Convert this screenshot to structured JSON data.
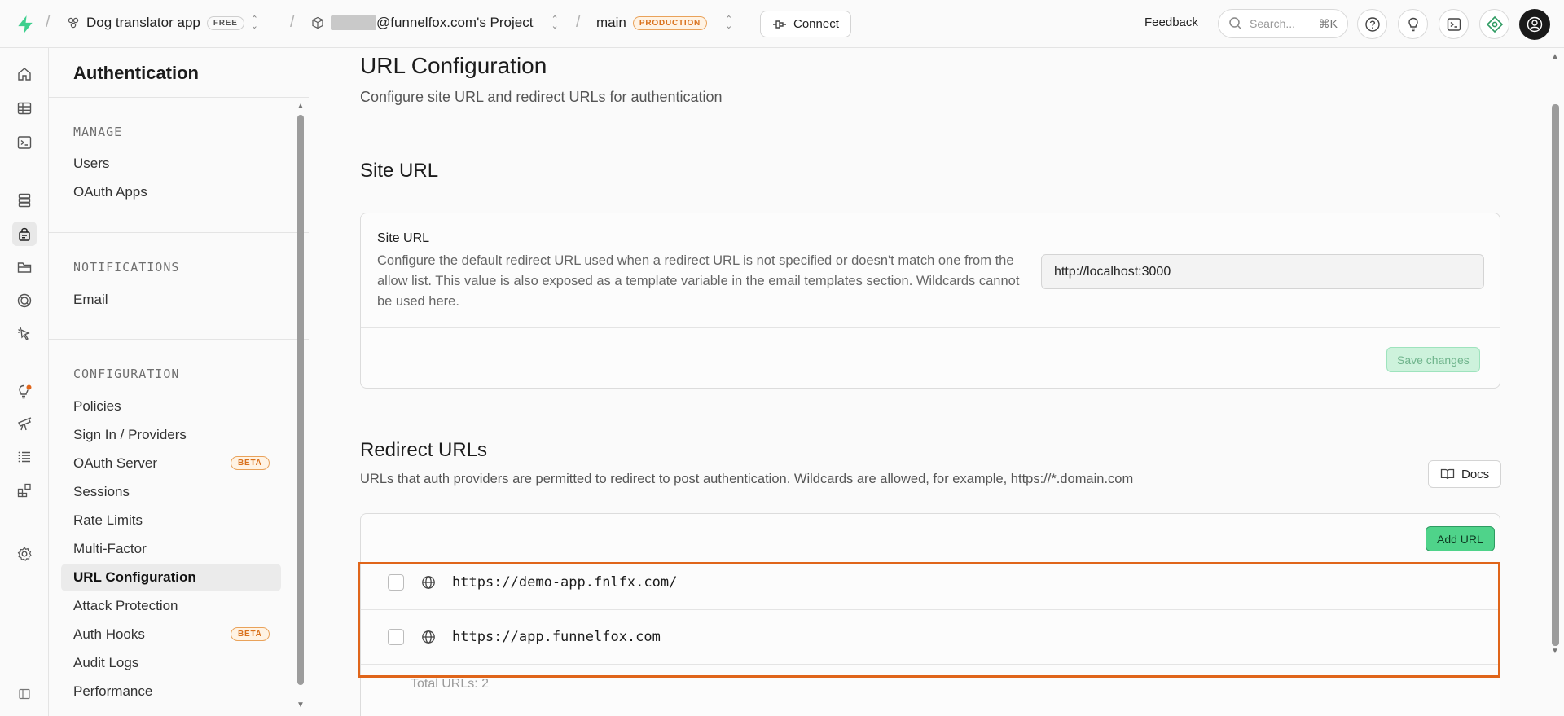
{
  "topbar": {
    "project_name": "Dog translator app",
    "plan_badge": "FREE",
    "org_name": "@funnelfox.com's Project",
    "branch": "main",
    "branch_badge": "PRODUCTION",
    "connect_label": "Connect",
    "feedback_label": "Feedback",
    "search_placeholder": "Search...",
    "search_shortcut": "⌘K"
  },
  "rail": {
    "icons": [
      "home-icon",
      "table-editor-icon",
      "sql-editor-icon",
      "database-icon",
      "authentication-icon",
      "storage-icon",
      "realtime-icon",
      "edge-functions-icon",
      "advisors-icon",
      "reports-icon",
      "logs-icon",
      "integrations-icon",
      "settings-icon",
      "collapse-sidebar-icon"
    ],
    "active": "authentication-icon"
  },
  "sidebar": {
    "title": "Authentication",
    "sections": {
      "manage": {
        "label": "MANAGE",
        "items": [
          "Users",
          "OAuth Apps"
        ]
      },
      "notifications": {
        "label": "NOTIFICATIONS",
        "items": [
          "Email"
        ]
      },
      "configuration": {
        "label": "CONFIGURATION",
        "items": [
          "Policies",
          "Sign In / Providers",
          "OAuth Server",
          "Sessions",
          "Rate Limits",
          "Multi-Factor",
          "URL Configuration",
          "Attack Protection",
          "Auth Hooks",
          "Audit Logs",
          "Performance"
        ]
      }
    },
    "beta_label": "BETA",
    "active_item": "URL Configuration"
  },
  "main": {
    "title": "URL Configuration",
    "subtitle": "Configure site URL and redirect URLs for authentication",
    "site_url": {
      "heading": "Site URL",
      "label": "Site URL",
      "description": "Configure the default redirect URL used when a redirect URL is not specified or doesn't match one from the allow list. This value is also exposed as a template variable in the email templates section. Wildcards cannot be used here.",
      "value": "http://localhost:3000",
      "save_label": "Save changes"
    },
    "redirect_urls": {
      "heading": "Redirect URLs",
      "description": "URLs that auth providers are permitted to redirect to post authentication. Wildcards are allowed, for example, https://*.domain.com",
      "docs_label": "Docs",
      "add_label": "Add URL",
      "urls": [
        "https://demo-app.fnlfx.com/",
        "https://app.funnelfox.com"
      ],
      "total_label": "Total URLs: 2"
    }
  },
  "colors": {
    "accent_green": "#3ecf8e",
    "highlight_orange": "#e0651a",
    "beta_orange": "#d9711c"
  }
}
